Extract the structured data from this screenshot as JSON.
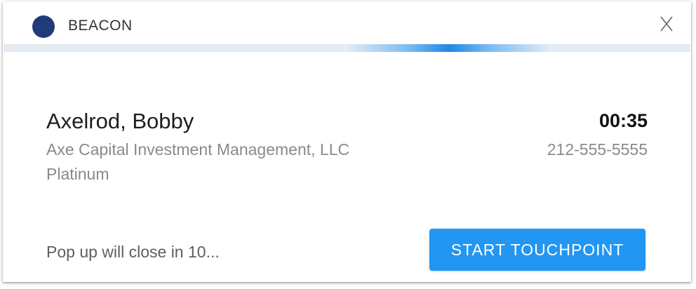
{
  "header": {
    "brand_name": "BEACON",
    "brand_dot_color": "#213b78",
    "close_label": "X"
  },
  "progress": {
    "accent_color": "#2196f3",
    "track_color": "#e4ebf3"
  },
  "caller": {
    "name": "Axelrod, Bobby",
    "company": "Axe Capital Investment Management, LLC",
    "tier": "Platinum",
    "timer": "00:35",
    "phone": "212-555-5555"
  },
  "footer": {
    "countdown_text": "Pop up will close in 10...",
    "start_button_label": "START TOUCHPOINT",
    "start_button_color": "#2196f3"
  }
}
